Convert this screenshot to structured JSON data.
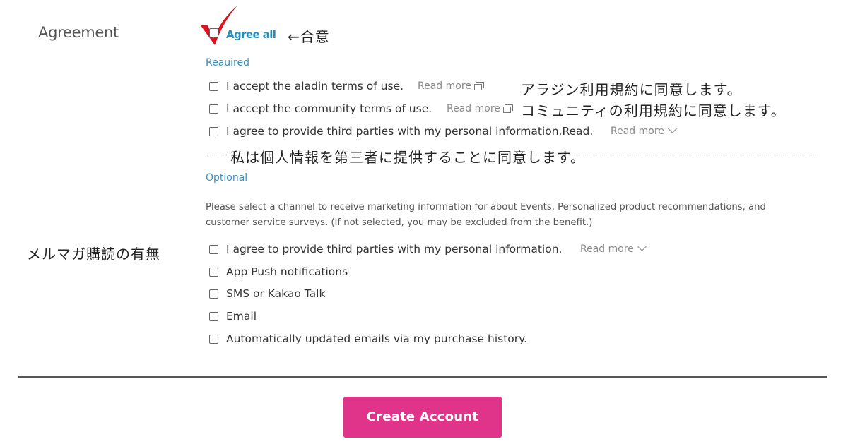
{
  "agreement": {
    "section_label": "Agreement",
    "agree_all_label": "Agree all",
    "agree_all_note": "←合意"
  },
  "required": {
    "group_label": "Reauired",
    "items": [
      {
        "label": "I accept the aladin terms of use.",
        "read_more": "Read more",
        "icon": "external-window-icon"
      },
      {
        "label": "I accept the community terms of use.",
        "read_more": "Read more",
        "icon": "external-window-icon"
      },
      {
        "label": "I agree to provide third parties with my personal information.Read.",
        "read_more": "Read more",
        "icon": "chevron-down-icon"
      }
    ],
    "notes": [
      "アラジン利用規約に同意します。",
      "コミュニティの利用規約に同意します。",
      "私は個人情報を第三者に提供することに同意します。"
    ]
  },
  "optional": {
    "group_label": "Optional",
    "description": "Please select a channel to receive marketing information for about Events, Personalized product recommendations, and customer service surveys. (If not selected, you may be excluded from the benefit.)",
    "side_note": "メルマガ購読の有無",
    "items": [
      {
        "label": "I agree to provide third parties with my personal information.",
        "read_more": "Read more",
        "icon": "chevron-down-icon"
      },
      {
        "label": "App Push notifications"
      },
      {
        "label": "SMS or Kakao Talk"
      },
      {
        "label": "Email"
      },
      {
        "label": "Automatically updated emails via my purchase history."
      }
    ]
  },
  "actions": {
    "create_account_label": "Create Account"
  },
  "colors": {
    "accent_blue": "#2a8db8",
    "button_pink": "#e0348a",
    "checkmark_red": "#e0101e"
  }
}
